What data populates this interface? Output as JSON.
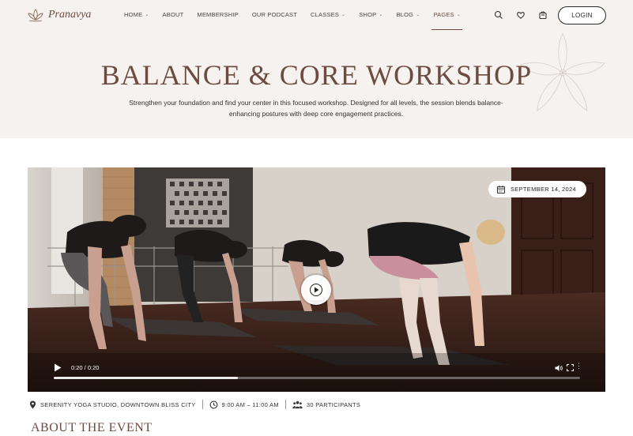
{
  "brand": {
    "name": "Pranavya",
    "logo_icon": "lotus-icon",
    "accent": "#6e4b40"
  },
  "nav": {
    "items": [
      {
        "label": "HOME",
        "has_dropdown": true
      },
      {
        "label": "ABOUT",
        "has_dropdown": false
      },
      {
        "label": "MEMBERSHIP",
        "has_dropdown": false
      },
      {
        "label": "OUR PODCAST",
        "has_dropdown": false
      },
      {
        "label": "CLASSES",
        "has_dropdown": true
      },
      {
        "label": "SHOP",
        "has_dropdown": true
      },
      {
        "label": "BLOG",
        "has_dropdown": true
      },
      {
        "label": "PAGES",
        "has_dropdown": true,
        "active": true
      }
    ],
    "icons": [
      "search-icon",
      "heart-icon",
      "cart-icon"
    ],
    "login_label": "LOGIN"
  },
  "hero": {
    "title": "BALANCE & CORE WORKSHOP",
    "description": "Strengthen your foundation and find your center in this focused workshop. Designed for all levels, the session blends balance-enhancing postures with deep core engagement practices."
  },
  "video": {
    "date": "SEPTEMBER 14, 2024",
    "time_display": "0:20 / 0:20",
    "progress": 0.35
  },
  "meta": {
    "location": "SERENITY YOGA STUDIO, DOWNTOWN BLISS CITY",
    "time": "9:00 AM – 11:00 AM",
    "participants": "30 PARTICIPANTS"
  },
  "section": {
    "heading": "ABOUT THE EVENT"
  }
}
